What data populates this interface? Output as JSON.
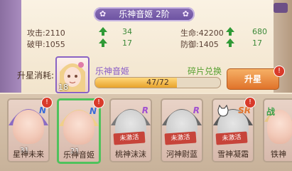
{
  "title": "乐神音姬 2阶",
  "stats": [
    {
      "label": "攻击:",
      "value": "2110",
      "inc": "34"
    },
    {
      "label": "生命:",
      "value": "42200",
      "inc": "680"
    },
    {
      "label": "破甲:",
      "value": "1055",
      "inc": "17"
    },
    {
      "label": "防御:",
      "value": "1405",
      "inc": "17"
    }
  ],
  "upgrade": {
    "label": "升星消耗:",
    "portrait_num": "18",
    "char_name": "乐神音姬",
    "fragment_link": "碎片兑换",
    "progress_text": "47/72",
    "progress_fraction": 0.6528,
    "button_label": "升星",
    "alert": "!"
  },
  "cards": [
    {
      "name": "星神未来",
      "rank": "N",
      "level": "31",
      "alert": "!",
      "locked": false,
      "selected": false
    },
    {
      "name": "乐神音姬",
      "rank": "N",
      "level": "21",
      "alert": "!",
      "locked": false,
      "selected": true
    },
    {
      "name": "桃神沫沫",
      "rank": "R",
      "locked": true,
      "lock_text": "未激活",
      "selected": false
    },
    {
      "name": "河神尉蓝",
      "rank": "R",
      "locked": true,
      "lock_text": "未激活",
      "selected": false
    },
    {
      "name": "雪神凝霜",
      "rank": "SR",
      "alert": "!",
      "locked": true,
      "lock_text": "未激活",
      "selected": false
    },
    {
      "name": "铁神",
      "rank": "战",
      "locked": false,
      "selected": false
    }
  ],
  "colors": {
    "accent_purple": "#7a5cb4",
    "progress": "#e7a22c",
    "up_green": "#2f9a36",
    "button": "#e0732b"
  }
}
